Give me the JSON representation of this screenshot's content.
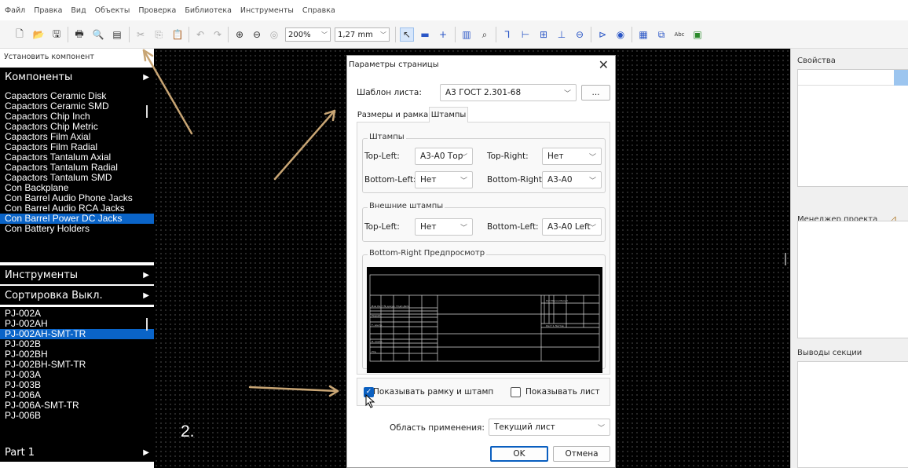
{
  "menu": [
    "Файл",
    "Правка",
    "Вид",
    "Объекты",
    "Проверка",
    "Библиотека",
    "Инструменты",
    "Справка"
  ],
  "toolbar": {
    "zoom": "200%",
    "grid": "1,27 mm"
  },
  "left": {
    "title": "Установить компонент",
    "components_header": "Компоненты",
    "components": [
      "Capactors Ceramic Disk",
      "Capactors Ceramic SMD",
      "Capactors Chip Inch",
      "Capactors Chip Metric",
      "Capactors Film Axial",
      "Capactors Film Radial",
      "Capactors Tantalum Axial",
      "Capactors Tantalum Radial",
      "Capactors Tantalum SMD",
      "Con Backplane",
      "Con Barrel Audio Phone Jacks",
      "Con Barrel Audio RCA Jacks",
      "Con Barrel Power DC Jacks",
      "Con Battery Holders"
    ],
    "components_selected": 12,
    "tools_header": "Инструменты",
    "sort_header": "Сортировка Выкл.",
    "parts": [
      "PJ-002A",
      "PJ-002AH",
      "PJ-002AH-SMT-TR",
      "PJ-002B",
      "PJ-002BH",
      "PJ-002BH-SMT-TR",
      "PJ-003A",
      "PJ-003B",
      "PJ-006A",
      "PJ-006A-SMT-TR",
      "PJ-006B"
    ],
    "parts_selected": 2,
    "part_header": "Part 1"
  },
  "canvas": {
    "step_label": "2."
  },
  "right": {
    "properties": "Свойства",
    "project_manager": "Менеджер проекта",
    "section_pins": "Выводы секции"
  },
  "dialog": {
    "title": "Параметры страницы",
    "close": "✕",
    "template_label": "Шаблон листа:",
    "template_value": "А3 ГОСТ 2.301-68",
    "browse": "...",
    "tab_size": "Размеры и рамка",
    "tab_stamps": "Штампы",
    "stamps_group": "Штампы",
    "top_left_label": "Top-Left:",
    "top_left_value": "А3-А0 Тор",
    "top_right_label": "Top-Right:",
    "top_right_value": "Нет",
    "bottom_left_label": "Bottom-Left:",
    "bottom_left_value": "Нет",
    "bottom_right_label": "Bottom-Right:",
    "bottom_right_value": "А3-А0",
    "ext_group": "Внешние штампы",
    "ext_top_left_label": "Top-Left:",
    "ext_top_left_value": "Нет",
    "ext_bottom_left_label": "Bottom-Left:",
    "ext_bottom_left_value": "А3-А0 Left",
    "preview_group": "Bottom-Right Предпросмотр",
    "show_frame_label": "Показывать рамку и штамп",
    "show_frame_checked": true,
    "show_sheet_label": "Показывать лист",
    "show_sheet_checked": false,
    "scope_label": "Область применения:",
    "scope_value": "Текущий лист",
    "ok": "OK",
    "cancel": "Отмена"
  },
  "annotations": {
    "arrow_color": "#c8a574"
  }
}
